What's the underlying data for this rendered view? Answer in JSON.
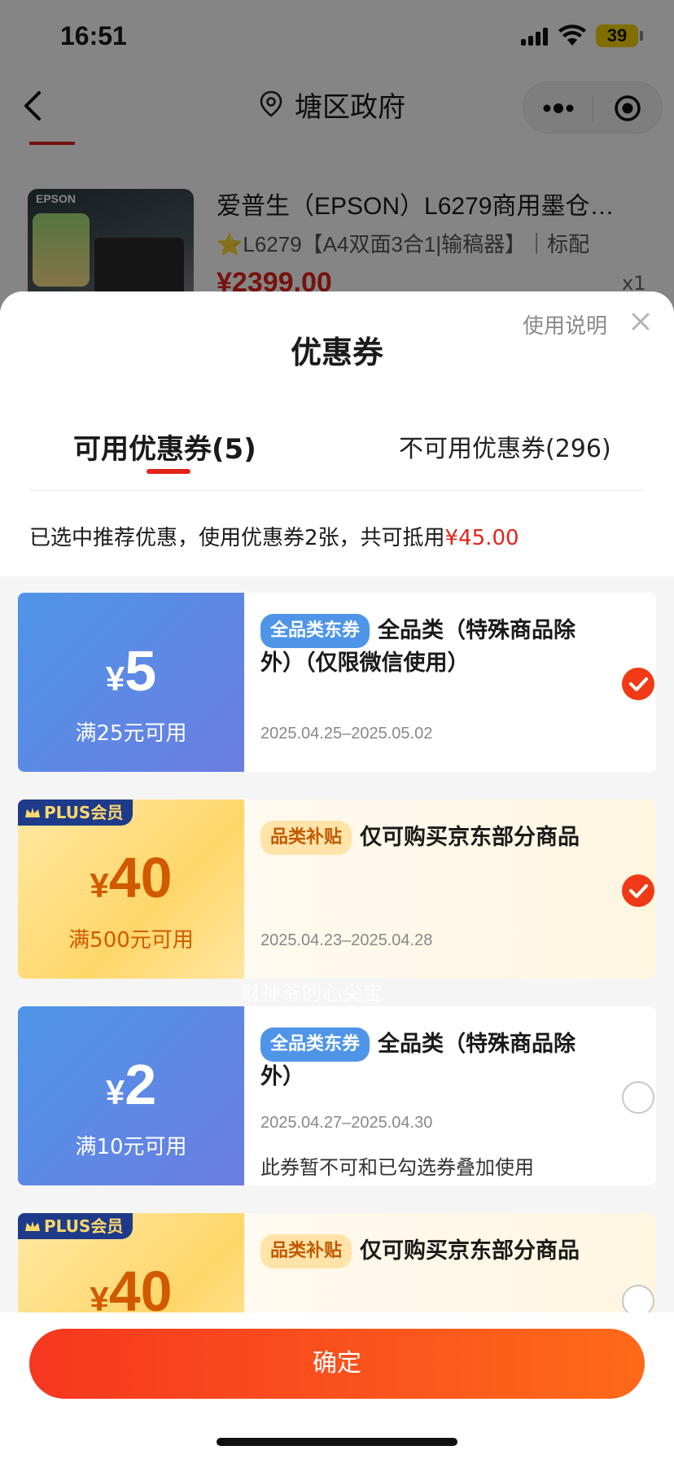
{
  "status_bar": {
    "time": "16:51",
    "battery": "39"
  },
  "nav": {
    "title": "塘区政府"
  },
  "product": {
    "brand": "EPSON",
    "title": "爱普生（EPSON）L6279商用墨仓…",
    "spec": "⭐L6279【A4双面3合1|输稿器】｜标配",
    "price": "¥2399.00",
    "qty": "x1"
  },
  "sheet": {
    "instructions": "使用说明",
    "title": "优惠券",
    "tabs": {
      "available": "可用优惠券(5)",
      "unavailable": "不可用优惠券(296)"
    },
    "summary_prefix": "已选中推荐优惠，使用优惠券2张，共可抵用",
    "summary_amount": "¥45.00"
  },
  "watermark": "财神爷的心尖宝",
  "coupons": [
    {
      "currency": "¥",
      "amount": "5",
      "condition": "满25元可用",
      "tag": "全品类东券",
      "desc": "全品类（特殊商品除外）（仅限微信使用）",
      "date": "2025.04.25–2025.05.02",
      "note": "",
      "selected": true,
      "style": "blue"
    },
    {
      "plus_label": "PLUS会员",
      "currency": "¥",
      "amount": "40",
      "condition": "满500元可用",
      "tag": "品类补贴",
      "desc": "仅可购买京东部分商品",
      "date": "2025.04.23–2025.04.28",
      "note": "",
      "selected": true,
      "style": "gold"
    },
    {
      "currency": "¥",
      "amount": "2",
      "condition": "满10元可用",
      "tag": "全品类东券",
      "desc": "全品类（特殊商品除外）",
      "date": "2025.04.27–2025.04.30",
      "note": "此券暂不可和已勾选券叠加使用",
      "selected": false,
      "style": "blue"
    },
    {
      "plus_label": "PLUS会员",
      "currency": "¥",
      "amount": "40",
      "condition": "",
      "tag": "品类补贴",
      "desc": "仅可购买京东部分商品",
      "date": "",
      "note": "",
      "selected": false,
      "style": "gold"
    }
  ],
  "footer": {
    "confirm": "确定"
  },
  "colors": {
    "accent": "#e2231a",
    "button_start": "#f5371f",
    "button_end": "#ff6a1a",
    "coupon_blue": "#4e95e8",
    "coupon_gold": "#ffd66a"
  }
}
